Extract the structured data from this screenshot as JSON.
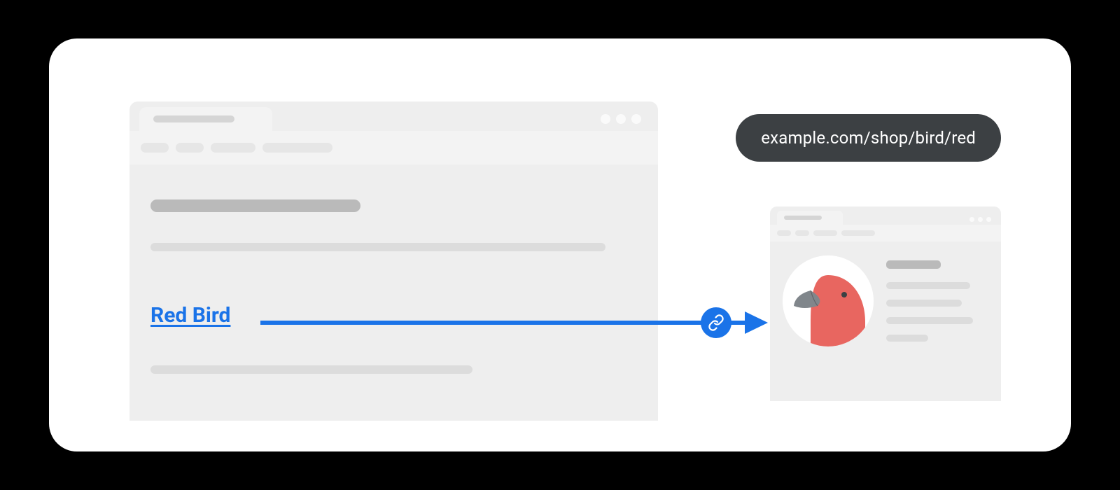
{
  "diagram": {
    "link_text": "Red Bird",
    "destination_url": "example.com/shop/bird/red"
  },
  "colors": {
    "link_blue": "#1a73e8",
    "url_pill_bg": "#3c4043",
    "bird_red": "#e86660",
    "bird_beak": "#80868b"
  }
}
